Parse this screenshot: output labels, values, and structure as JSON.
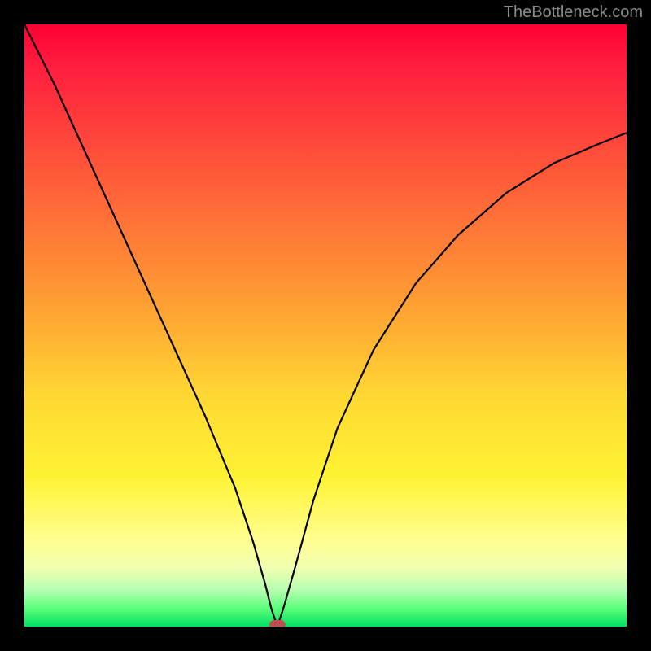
{
  "watermark": "TheBottleneck.com",
  "chart_data": {
    "type": "line",
    "title": "",
    "xlabel": "",
    "ylabel": "",
    "xlim": [
      0,
      100
    ],
    "ylim": [
      0,
      100
    ],
    "grid": false,
    "legend": false,
    "background_gradient": {
      "top_color": "#ff0033",
      "bottom_color": "#00e060",
      "meaning": "bottleneck % (top=high, bottom=low)"
    },
    "marker": {
      "x": 42,
      "y": 0,
      "color": "#c05050"
    },
    "series": [
      {
        "name": "bottleneck-curve",
        "color": "#000000",
        "x": [
          0,
          5,
          10,
          15,
          20,
          25,
          30,
          35,
          38,
          40,
          41,
          42,
          43,
          45,
          48,
          52,
          58,
          65,
          72,
          80,
          88,
          95,
          100
        ],
        "y": [
          100,
          90,
          79,
          68,
          57,
          46,
          35,
          23,
          14,
          7,
          3,
          0,
          3,
          10,
          21,
          33,
          46,
          57,
          65,
          72,
          77,
          80,
          82
        ]
      }
    ]
  }
}
